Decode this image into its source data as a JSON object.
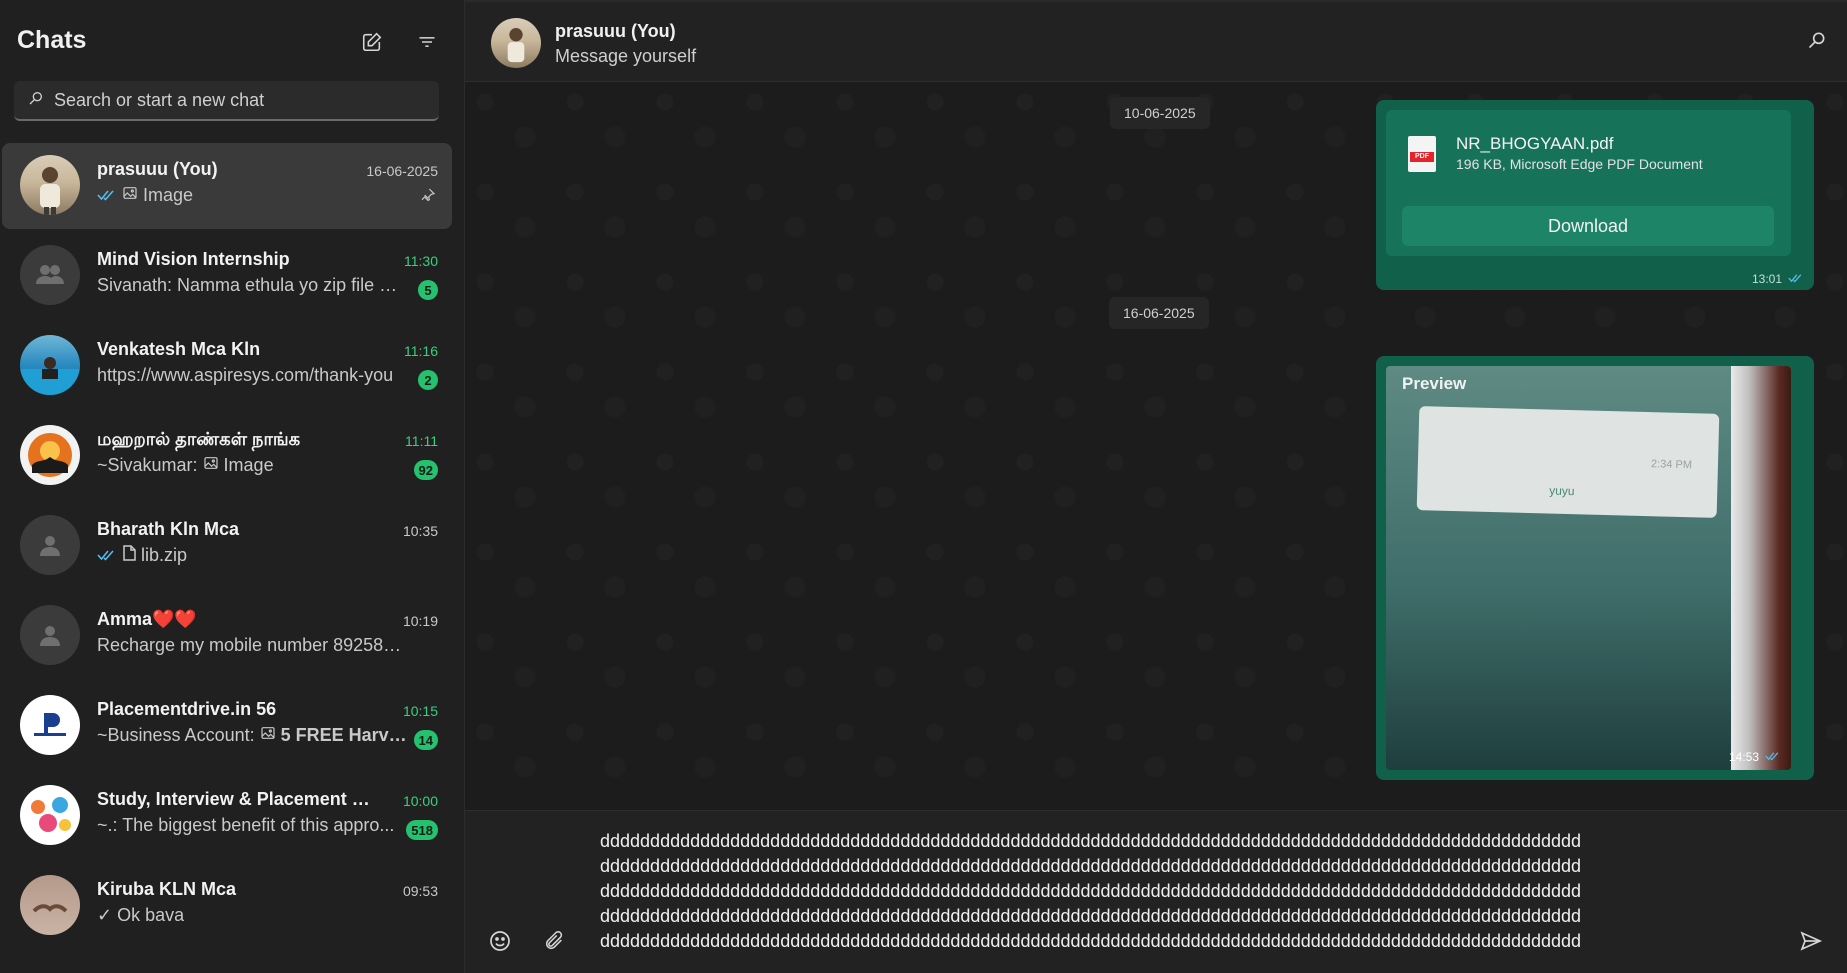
{
  "sidebar": {
    "title": "Chats",
    "search_placeholder": "Search or start a new chat",
    "chats": [
      {
        "name": "prasuuu (You)",
        "preview": "Image",
        "time": "16-06-2025",
        "unread": "",
        "ticks": "double-blue",
        "icon": "image-icon",
        "pinned": true
      },
      {
        "name": "Mind Vision Internship",
        "preview": "Sivanath: Namma ethula yo zip file up...",
        "time": "11:30",
        "unread": "5"
      },
      {
        "name": "Venkatesh Mca Kln",
        "preview": "https://www.aspiresys.com/thank-you",
        "time": "11:16",
        "unread": "2"
      },
      {
        "name": "மஹறால் தாண்கள் நாங்க",
        "preview": "~Sivakumar: ",
        "preview_extra": "Image",
        "time": "11:11",
        "unread": "92"
      },
      {
        "name": "Bharath Kln Mca",
        "preview": "lib.zip",
        "time": "10:35",
        "unread": ""
      },
      {
        "name": "Amma❤️❤️",
        "preview": "Recharge my mobile number 89258180...",
        "time": "10:19",
        "unread": ""
      },
      {
        "name": "Placementdrive.in 56",
        "preview": "~Business Account: ",
        "preview_extra": "5 FREE Harva...",
        "time": "10:15",
        "unread": "14"
      },
      {
        "name": "Study, Interview & Placement Ma...",
        "preview": "~.: The biggest benefit of this appro...",
        "time": "10:00",
        "unread": "518"
      },
      {
        "name": "Kiruba KLN Mca",
        "preview": "✓ Ok bava",
        "time": "09:53",
        "unread": ""
      }
    ]
  },
  "main": {
    "title": "prasuuu (You)",
    "subtitle": "Message yourself",
    "dates": [
      "10-06-2025",
      "16-06-2025"
    ],
    "doc_message": {
      "file_name": "NR_BHOGYAAN.pdf",
      "file_meta": "196 KB, Microsoft Edge PDF Document",
      "download_label": "Download",
      "time": "13:01",
      "pdf_badge": "PDF"
    },
    "image_message": {
      "preview_label": "Preview",
      "inner_time": "2:34 PM",
      "inner_link": "yuyu",
      "time": "14:53"
    },
    "composer_text": "dddddddddddddddddddddddddddddddddddddddddddddddddddddddddddddddddddddddddddddddddddddddddddddddddd\ndddddddddddddddddddddddddddddddddddddddddddddddddddddddddddddddddddddddddddddddddddddddddddddddddd\ndddddddddddddddddddddddddddddddddddddddddddddddddddddddddddddddddddddddddddddddddddddddddddddddddd\ndddddddddddddddddddddddddddddddddddddddddddddddddddddddddddddddddddddddddddddddddddddddddddddddddd\ndddddddddddddddddddddddddddddddddddddddddddddddddddddddddddddddddddddddddddddddddddddddddddddddddd"
  },
  "colors": {
    "accent_green": "#25c16f",
    "bubble_green": "#11614a",
    "read_tick_blue": "#53bdeb"
  }
}
